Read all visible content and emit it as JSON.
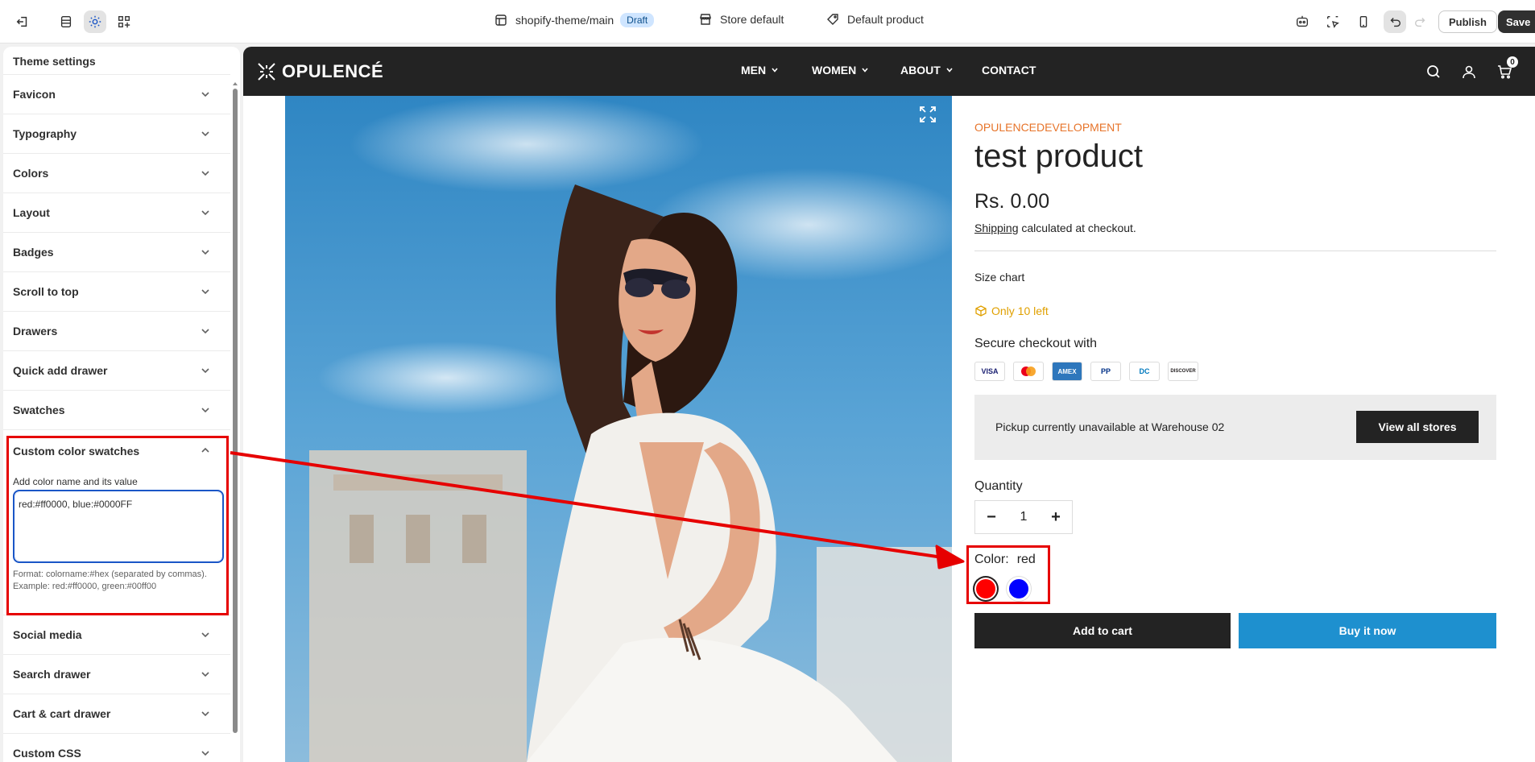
{
  "topbar": {
    "theme_name": "shopify-theme/main",
    "status": "Draft",
    "store": "Store default",
    "template": "Default product",
    "publish_label": "Publish",
    "save_label": "Save"
  },
  "sidebar": {
    "title": "Theme settings",
    "items": [
      {
        "label": "Favicon"
      },
      {
        "label": "Typography"
      },
      {
        "label": "Colors"
      },
      {
        "label": "Layout"
      },
      {
        "label": "Badges"
      },
      {
        "label": "Scroll to top"
      },
      {
        "label": "Drawers"
      },
      {
        "label": "Quick add drawer"
      },
      {
        "label": "Swatches"
      }
    ],
    "expanded": {
      "label": "Custom color swatches",
      "field_label": "Add color name and its value",
      "value": "red:#ff0000, blue:#0000FF",
      "help": "Format: colorname:#hex (separated by commas). Example: red:#ff0000, green:#00ff00"
    },
    "items_after": [
      {
        "label": "Social media"
      },
      {
        "label": "Search drawer"
      },
      {
        "label": "Cart & cart drawer"
      },
      {
        "label": "Custom CSS"
      }
    ]
  },
  "store": {
    "logo": "OPULENCÉ",
    "nav": [
      "MEN",
      "WOMEN",
      "ABOUT",
      "CONTACT"
    ],
    "cart_count": "0"
  },
  "product": {
    "vendor": "OPULENCEDEVELOPMENT",
    "title": "test product",
    "price": "Rs. 0.00",
    "shipping_link": "Shipping",
    "shipping_text": " calculated at checkout.",
    "size_chart": "Size chart",
    "stock": "Only 10 left",
    "secure": "Secure checkout with",
    "payments": [
      "VISA",
      "MC",
      "AMEX",
      "PP",
      "DC",
      "DISCOVER"
    ],
    "pickup": "Pickup currently unavailable at Warehouse 02",
    "view_stores": "View all stores",
    "quantity_label": "Quantity",
    "quantity": "1",
    "color_label": "Color:",
    "color_value": "red",
    "swatches": [
      "#ff0000",
      "#0000ff"
    ],
    "add_to_cart": "Add to cart",
    "buy_now": "Buy it now"
  },
  "colors": {
    "annotation": "#e60000",
    "vendor": "#e7742a",
    "stock": "#e0a000",
    "buy_button": "#1e90cf",
    "nav_bg": "#232323"
  }
}
